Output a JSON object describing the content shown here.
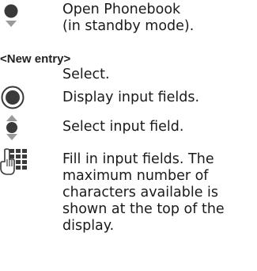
{
  "steps": [
    {
      "icon": "nav-key-down-icon",
      "lines": [
        "Open Phonebook",
        "(in standby mode)."
      ]
    },
    {
      "label": "<New entry>",
      "lines": [
        "Select."
      ]
    },
    {
      "icon": "center-select-key-icon",
      "lines": [
        "Display input fields."
      ]
    },
    {
      "icon": "nav-key-up-down-icon",
      "lines": [
        "Select input field."
      ]
    },
    {
      "icon": "keypad-input-icon",
      "lines": [
        "Fill in input fields. The",
        "maximum number of",
        "characters available is",
        "shown at the top of the",
        "display."
      ]
    }
  ]
}
